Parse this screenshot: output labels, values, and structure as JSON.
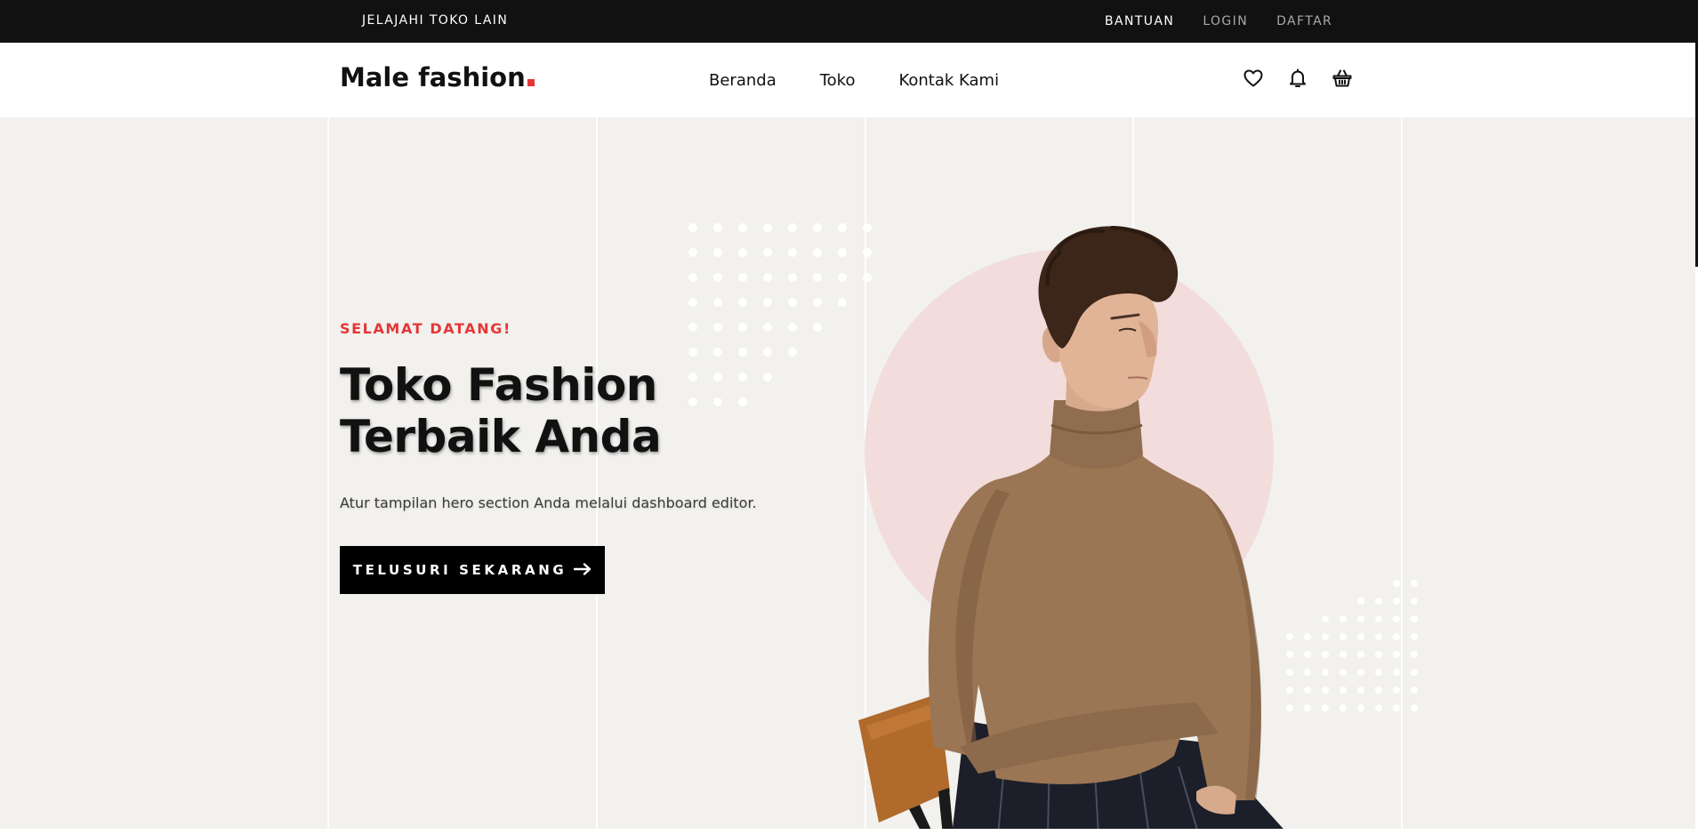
{
  "topbar": {
    "explore_label": "JELAJAHI TOKO LAIN",
    "help_label": "BANTUAN",
    "login_label": "LOGIN",
    "register_label": "DAFTAR"
  },
  "header": {
    "logo_text": "Male fashion",
    "nav": [
      {
        "label": "Beranda"
      },
      {
        "label": "Toko"
      },
      {
        "label": "Kontak Kami"
      }
    ],
    "icons": [
      "heart-icon",
      "bell-icon",
      "basket-icon"
    ]
  },
  "hero": {
    "subtitle": "SELAMAT DATANG!",
    "title_line1": "Toko Fashion",
    "title_line2": "Terbaik Anda",
    "description": "Atur tampilan hero section Anda melalui dashboard editor.",
    "cta_label": "TELUSURI SEKARANG",
    "cta_icon": "arrow-right-icon"
  },
  "colors": {
    "accent": "#e53637",
    "topbar_bg": "#111111",
    "hero_bg": "#f2f1ee",
    "circle": "#f2dcdc",
    "sweater": "#9b7654"
  }
}
